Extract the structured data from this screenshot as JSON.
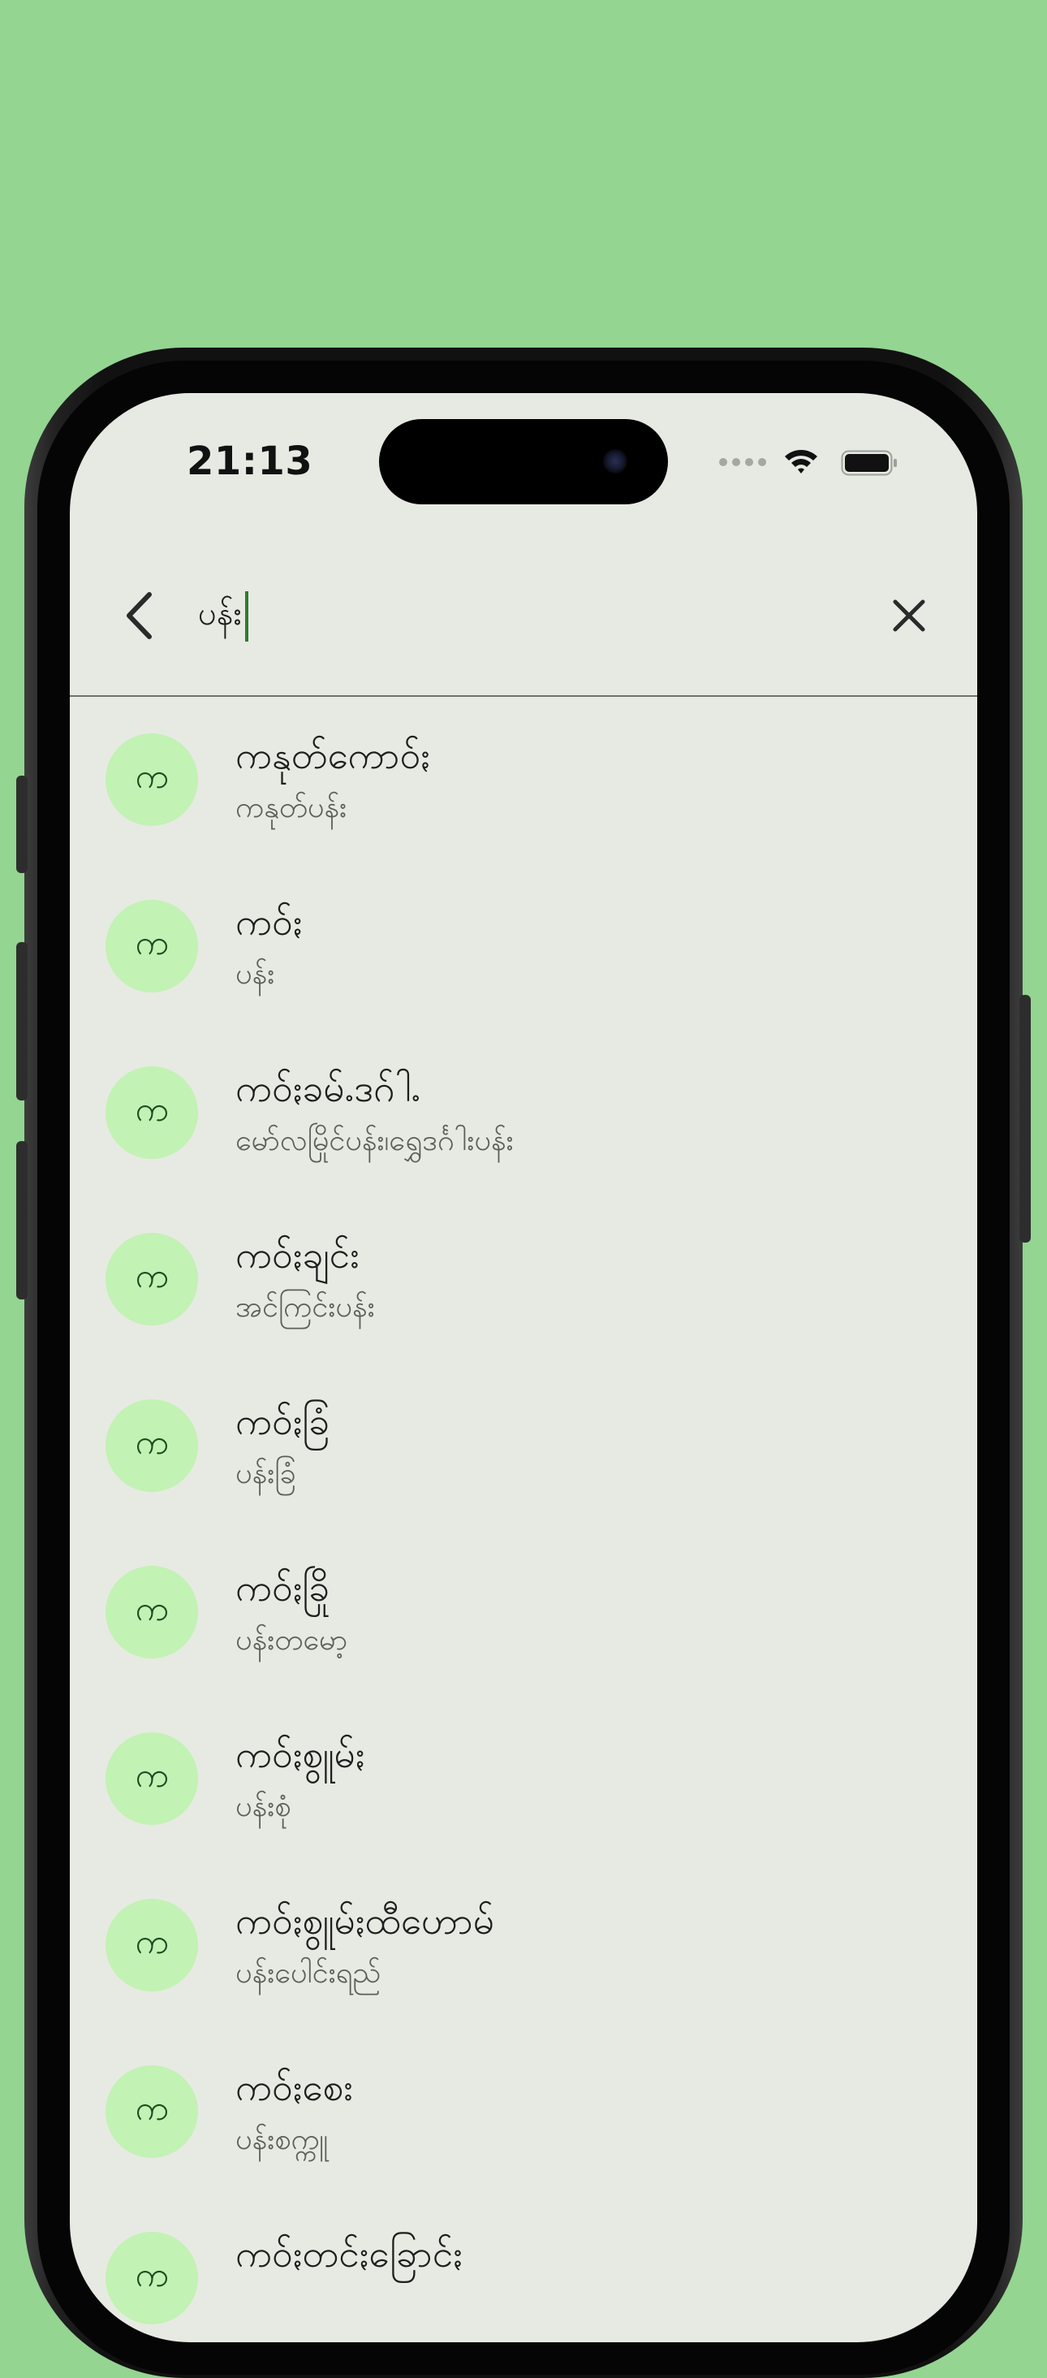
{
  "status_bar": {
    "time": "21:13"
  },
  "search": {
    "query": "ပန်း",
    "back_icon": "chevron-left-icon",
    "clear_icon": "close-icon"
  },
  "colors": {
    "background": "#93d591",
    "screen": "#e7eae2",
    "avatar": "#c2f2b4",
    "caret": "#2c7d2c"
  },
  "results": [
    {
      "avatar": "က",
      "title": "ကနုတ်ကောဝ်ႏ",
      "subtitle": "ကနုတ်ပန်း"
    },
    {
      "avatar": "က",
      "title": "ကဝ်ႏ",
      "subtitle": "ပန်း"
    },
    {
      "avatar": "က",
      "title": "ကဝ်ႏခမ်ႉဒဂ်ါႉ",
      "subtitle": "မော်လမြိုင်ပန်း၊ရွှေဒင်္ဂါးပန်း"
    },
    {
      "avatar": "က",
      "title": "ကဝ်ႏချင်း",
      "subtitle": "အင်ကြင်းပန်း"
    },
    {
      "avatar": "က",
      "title": "ကဝ်ႏခြံ",
      "subtitle": "ပန်းခြံ"
    },
    {
      "avatar": "က",
      "title": "ကဝ်ႏခြို",
      "subtitle": "ပန်းတမော့"
    },
    {
      "avatar": "က",
      "title": "ကဝ်ႏစွူမ်ႏ",
      "subtitle": "ပန်းစုံ"
    },
    {
      "avatar": "က",
      "title": "ကဝ်ႏစွူမ်ႏထီဟောမ်",
      "subtitle": "ပန်းပေါင်းရည်"
    },
    {
      "avatar": "က",
      "title": "ကဝ်ႏစေး",
      "subtitle": "ပန်းစက္ကူ"
    },
    {
      "avatar": "က",
      "title": "ကဝ်ႏတင်ႏခြောင်ႏ",
      "subtitle": ""
    }
  ]
}
